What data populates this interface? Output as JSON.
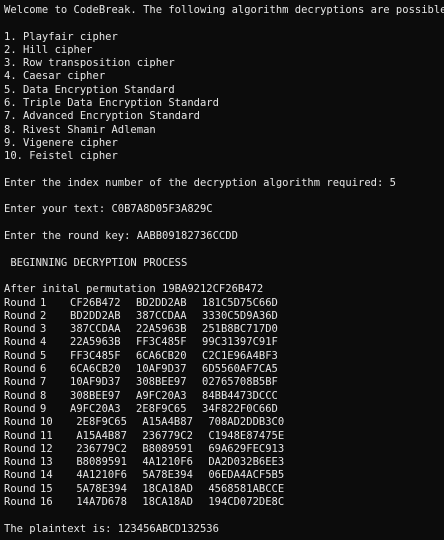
{
  "console": {
    "welcome": "Welcome to CodeBreak. The following algorithm decryptions are possible.",
    "menu": [
      "1. Playfair cipher",
      "2. Hill cipher",
      "3. Row transposition cipher",
      "4. Caesar cipher",
      "5. Data Encryption Standard",
      "6. Triple Data Encryption Standard",
      "7. Advanced Encryption Standard",
      "8. Rivest Shamir Adleman",
      "9. Vigenere cipher",
      "10. Feistel cipher"
    ],
    "index_prompt": "Enter the index number of the decryption algorithm required: 5",
    "text_prompt": "Enter your text: C0B7A8D05F3A829C",
    "key_prompt": "Enter the round key: AABB09182736CCDD",
    "process_header": " BEGINNING DECRYPTION PROCESS",
    "initial_perm": "After inital permutation 19BA9212CF26B472",
    "rounds": [
      {
        "label": "Round",
        "num": "1",
        "left": "CF26B472",
        "right": "BD2DD2AB",
        "key": "181C5D75C66D"
      },
      {
        "label": "Round",
        "num": "2",
        "left": "BD2DD2AB",
        "right": "387CCDAA",
        "key": "3330C5D9A36D"
      },
      {
        "label": "Round",
        "num": "3",
        "left": "387CCDAA",
        "right": "22A5963B",
        "key": "251B8BC717D0"
      },
      {
        "label": "Round",
        "num": "4",
        "left": "22A5963B",
        "right": "FF3C485F",
        "key": "99C31397C91F"
      },
      {
        "label": "Round",
        "num": "5",
        "left": "FF3C485F",
        "right": "6CA6CB20",
        "key": "C2C1E96A4BF3"
      },
      {
        "label": "Round",
        "num": "6",
        "left": "6CA6CB20",
        "right": "10AF9D37",
        "key": "6D5560AF7CA5"
      },
      {
        "label": "Round",
        "num": "7",
        "left": "10AF9D37",
        "right": "308BEE97",
        "key": "02765708B5BF"
      },
      {
        "label": "Round",
        "num": "8",
        "left": "308BEE97",
        "right": "A9FC20A3",
        "key": "84BB4473DCCC"
      },
      {
        "label": "Round",
        "num": "9",
        "left": "A9FC20A3",
        "right": "2E8F9C65",
        "key": "34F822F0C66D"
      },
      {
        "label": "Round",
        "num": "10",
        "left": " 2E8F9C65",
        "right": " A15A4B87",
        "key": " 708AD2DDB3C0"
      },
      {
        "label": "Round",
        "num": "11",
        "left": " A15A4B87",
        "right": " 236779C2",
        "key": " C1948E87475E"
      },
      {
        "label": "Round",
        "num": "12",
        "left": " 236779C2",
        "right": " B8089591",
        "key": " 69A629FEC913"
      },
      {
        "label": "Round",
        "num": "13",
        "left": " B8089591",
        "right": " 4A1210F6",
        "key": " DA2D032B6EE3"
      },
      {
        "label": "Round",
        "num": "14",
        "left": " 4A1210F6",
        "right": " 5A78E394",
        "key": " 06EDA4ACF5B5"
      },
      {
        "label": "Round",
        "num": "15",
        "left": " 5A78E394",
        "right": " 18CA18AD",
        "key": " 4568581ABCCE"
      },
      {
        "label": "Round",
        "num": "16",
        "left": " 14A7D678",
        "right": " 18CA18AD",
        "key": " 194CD072DE8C"
      }
    ],
    "plaintext": "The plaintext is: 123456ABCD132536"
  }
}
